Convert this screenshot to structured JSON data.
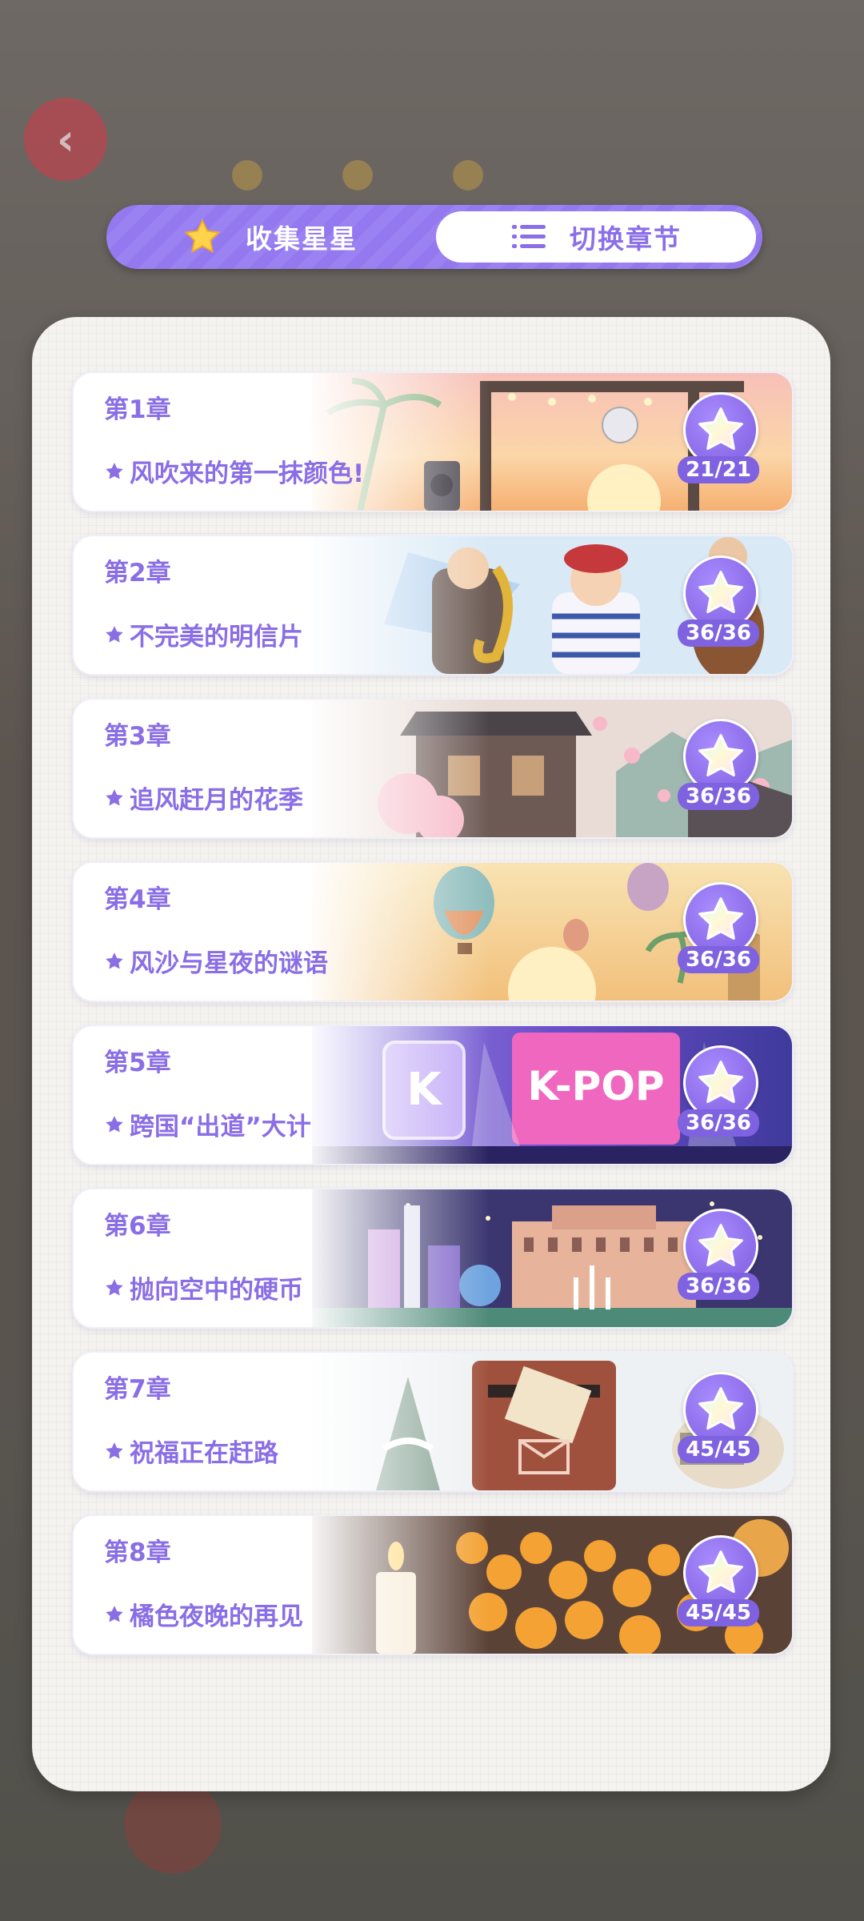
{
  "tabs": {
    "collect_label": "收集星星",
    "switch_label": "切换章节"
  },
  "colors": {
    "accent": "#8b6fe8",
    "tab_bg": "#9b82f2",
    "panel_bg": "#f4f3f0"
  },
  "chapters": [
    {
      "number": "第1章",
      "title": "风吹来的第一抹颜色!",
      "progress": "21/21",
      "icon": "star-icon"
    },
    {
      "number": "第2章",
      "title": "不完美的明信片",
      "progress": "36/36",
      "icon": "star-icon"
    },
    {
      "number": "第3章",
      "title": "追风赶月的花季",
      "progress": "36/36",
      "icon": "star-icon"
    },
    {
      "number": "第4章",
      "title": "风沙与星夜的谜语",
      "progress": "36/36",
      "icon": "star-icon"
    },
    {
      "number": "第5章",
      "title": "跨国“出道”大计",
      "progress": "36/36",
      "icon": "star-icon"
    },
    {
      "number": "第6章",
      "title": "抛向空中的硬币",
      "progress": "36/36",
      "icon": "star-icon"
    },
    {
      "number": "第7章",
      "title": "祝福正在赶路",
      "progress": "45/45",
      "icon": "star-icon"
    },
    {
      "number": "第8章",
      "title": "橘色夜晚的再见",
      "progress": "45/45",
      "icon": "star-icon"
    }
  ],
  "chapter_art": {
    "c5_sign": "K-POP",
    "c5_block": "K"
  }
}
